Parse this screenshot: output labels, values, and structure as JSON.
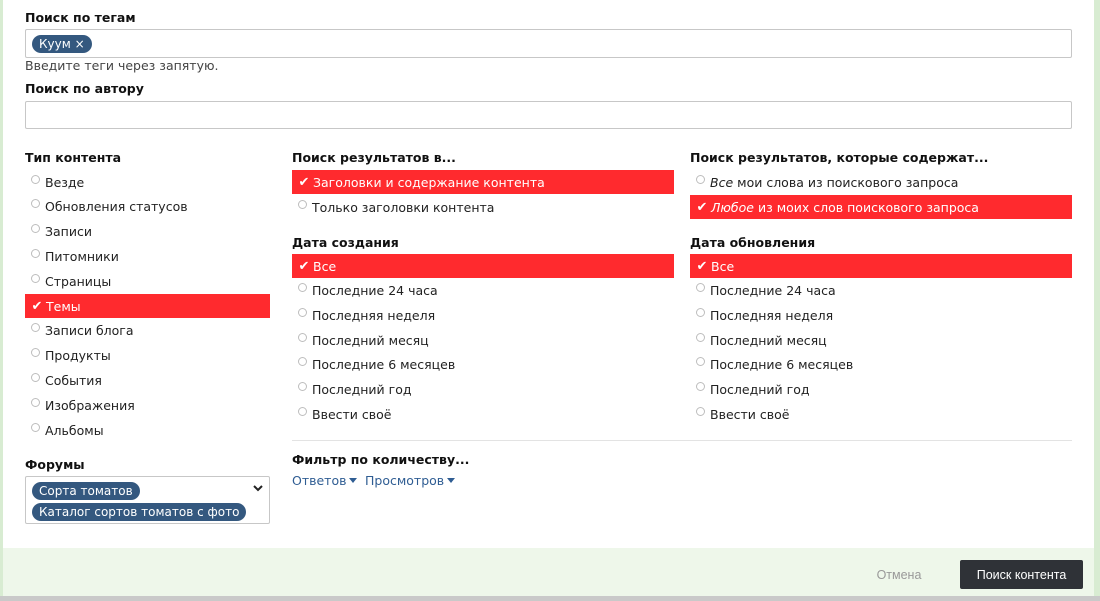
{
  "tags": {
    "label": "Поиск по тегам",
    "chips": [
      "Куум ×"
    ],
    "hint": "Введите теги через запятую."
  },
  "author": {
    "label": "Поиск по автору",
    "value": ""
  },
  "content_type": {
    "label": "Тип контента",
    "options": [
      {
        "label": "Везде",
        "selected": false
      },
      {
        "label": "Обновления статусов",
        "selected": false
      },
      {
        "label": "Записи",
        "selected": false
      },
      {
        "label": "Питомники",
        "selected": false
      },
      {
        "label": "Страницы",
        "selected": false
      },
      {
        "label": "Темы",
        "selected": true
      },
      {
        "label": "Записи блога",
        "selected": false
      },
      {
        "label": "Продукты",
        "selected": false
      },
      {
        "label": "События",
        "selected": false
      },
      {
        "label": "Изображения",
        "selected": false
      },
      {
        "label": "Альбомы",
        "selected": false
      }
    ]
  },
  "search_in": {
    "label": "Поиск результатов в...",
    "options": [
      {
        "label": "Заголовки и содержание контента",
        "selected": true
      },
      {
        "label": "Только заголовки контента",
        "selected": false
      }
    ]
  },
  "contains": {
    "label": "Поиск результатов, которые содержат...",
    "options": [
      {
        "em": "Все",
        "rest": "мои слова из поискового запроса",
        "selected": false
      },
      {
        "em": "Любое",
        "rest": "из моих слов поискового запроса",
        "selected": true
      }
    ]
  },
  "created": {
    "label": "Дата создания",
    "options": [
      {
        "label": "Все",
        "selected": true
      },
      {
        "label": "Последние 24 часа",
        "selected": false
      },
      {
        "label": "Последняя неделя",
        "selected": false
      },
      {
        "label": "Последний месяц",
        "selected": false
      },
      {
        "label": "Последние 6 месяцев",
        "selected": false
      },
      {
        "label": "Последний год",
        "selected": false
      },
      {
        "label": "Ввести своё",
        "selected": false
      }
    ]
  },
  "updated": {
    "label": "Дата обновления",
    "options": [
      {
        "label": "Все",
        "selected": true
      },
      {
        "label": "Последние 24 часа",
        "selected": false
      },
      {
        "label": "Последняя неделя",
        "selected": false
      },
      {
        "label": "Последний месяц",
        "selected": false
      },
      {
        "label": "Последние 6 месяцев",
        "selected": false
      },
      {
        "label": "Последний год",
        "selected": false
      },
      {
        "label": "Ввести своё",
        "selected": false
      }
    ]
  },
  "filter": {
    "label": "Фильтр по количеству...",
    "answers": "Ответов",
    "views": "Просмотров"
  },
  "forums": {
    "label": "Форумы",
    "chips": [
      "Сорта томатов",
      "Каталог сортов томатов с фото"
    ]
  },
  "footer": {
    "cancel": "Отмена",
    "submit": "Поиск контента"
  }
}
